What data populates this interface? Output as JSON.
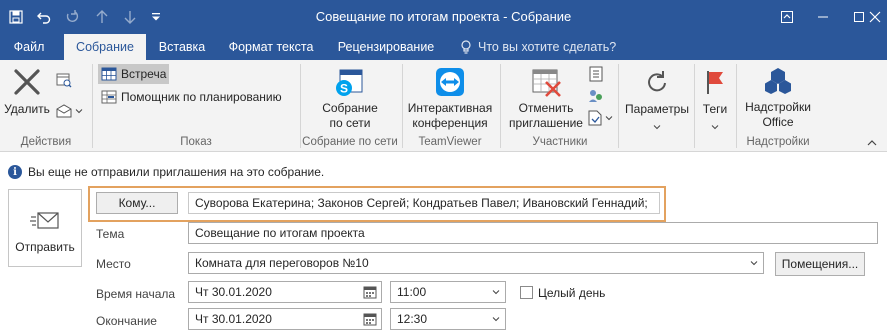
{
  "window": {
    "title": "Совещание по итогам проекта - Собрание"
  },
  "tabs": [
    {
      "label": "Файл"
    },
    {
      "label": "Собрание"
    },
    {
      "label": "Вставка"
    },
    {
      "label": "Формат текста"
    },
    {
      "label": "Рецензирование"
    }
  ],
  "tellme": {
    "label": "Что вы хотите сделать?"
  },
  "ribbon": {
    "actions": {
      "delete_label": "Удалить",
      "group_label": "Действия"
    },
    "show": {
      "meeting_label": "Встреча",
      "scheduling_label": "Помощник по планированию",
      "group_label": "Показ"
    },
    "online": {
      "button_line1": "Собрание",
      "button_line2": "по сети",
      "group_label": "Собрание по сети"
    },
    "teamviewer": {
      "button_line1": "Интерактивная",
      "button_line2": "конференция",
      "group_label": "TeamViewer"
    },
    "attendees": {
      "button_line1": "Отменить",
      "button_line2": "приглашение",
      "group_label": "Участники"
    },
    "options": {
      "label": "Параметры"
    },
    "tags": {
      "label": "Теги"
    },
    "addins": {
      "button_line1": "Надстройки",
      "button_line2": "Office",
      "group_label": "Надстройки"
    }
  },
  "infobar": {
    "text": "Вы еще не отправили приглашения на это собрание."
  },
  "form": {
    "send_label": "Отправить",
    "to_button": "Кому...",
    "to_value": "Суворова Екатерина; Законов Сергей; Кондратьев Павел; Ивановский Геннадий;",
    "subject_label": "Тема",
    "subject_value": "Совещание по итогам проекта",
    "location_label": "Место",
    "location_value": "Комната для переговоров №10",
    "rooms_button": "Помещения...",
    "start_label": "Время начала",
    "start_date": "Чт 30.01.2020",
    "start_time": "11:00",
    "allday_label": "Целый день",
    "end_label": "Окончание",
    "end_date": "Чт 30.01.2020",
    "end_time": "12:30"
  }
}
